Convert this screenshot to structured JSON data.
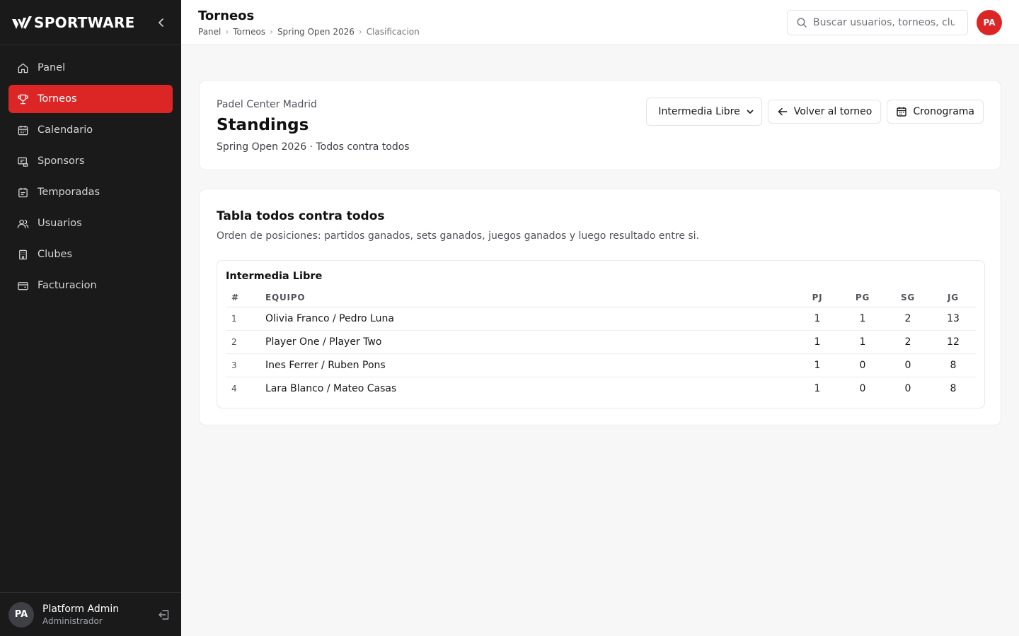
{
  "sidebar": {
    "brand": "SPORTWARE",
    "items": [
      {
        "label": "Panel",
        "icon": "home-icon"
      },
      {
        "label": "Torneos",
        "icon": "trophy-icon",
        "active": true
      },
      {
        "label": "Calendario",
        "icon": "calendar-icon"
      },
      {
        "label": "Sponsors",
        "icon": "sponsor-icon"
      },
      {
        "label": "Temporadas",
        "icon": "calendar-list-icon"
      },
      {
        "label": "Usuarios",
        "icon": "users-icon"
      },
      {
        "label": "Clubes",
        "icon": "building-icon"
      },
      {
        "label": "Facturacion",
        "icon": "wallet-icon"
      }
    ],
    "user": {
      "initials": "PA",
      "name": "Platform Admin",
      "role": "Administrador"
    }
  },
  "header": {
    "title": "Torneos",
    "breadcrumb": [
      "Panel",
      "Torneos",
      "Spring Open 2026",
      "Clasificacion"
    ],
    "search_placeholder": "Buscar usuarios, torneos, clubes",
    "avatar_initials": "PA"
  },
  "summary": {
    "club": "Padel Center Madrid",
    "title": "Standings",
    "subtitle": "Spring Open 2026 · Todos contra todos",
    "category_select": "Intermedia Libre",
    "back_button": "Volver al torneo",
    "schedule_button": "Cronograma"
  },
  "standings": {
    "title": "Tabla todos contra todos",
    "description": "Orden de posiciones: partidos ganados, sets ganados, juegos ganados y luego resultado entre si.",
    "category": "Intermedia Libre",
    "columns": [
      "#",
      "EQUIPO",
      "PJ",
      "PG",
      "SG",
      "JG"
    ],
    "rows": [
      {
        "pos": "1",
        "team": "Olivia Franco / Pedro Luna",
        "pj": "1",
        "pg": "1",
        "sg": "2",
        "jg": "13"
      },
      {
        "pos": "2",
        "team": "Player One / Player Two",
        "pj": "1",
        "pg": "1",
        "sg": "2",
        "jg": "12"
      },
      {
        "pos": "3",
        "team": "Ines Ferrer / Ruben Pons",
        "pj": "1",
        "pg": "0",
        "sg": "0",
        "jg": "8"
      },
      {
        "pos": "4",
        "team": "Lara Blanco / Mateo Casas",
        "pj": "1",
        "pg": "0",
        "sg": "0",
        "jg": "8"
      }
    ]
  },
  "colors": {
    "accent": "#dc2626",
    "sidebar_bg": "#1a1a1a"
  }
}
